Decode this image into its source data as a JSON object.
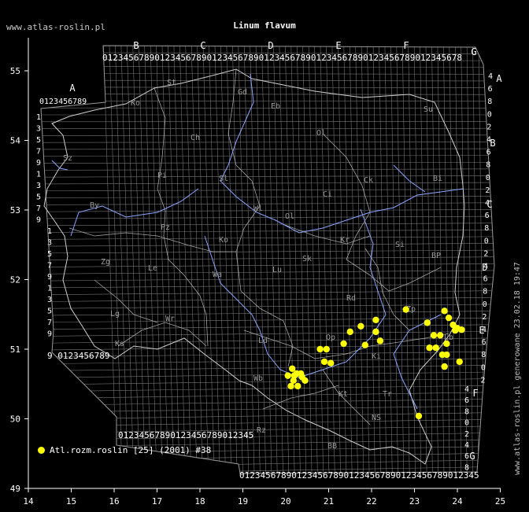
{
  "site_label": "www.atlas-roslin.pl",
  "title": "Linum flavum",
  "side_text": "www.atlas-roslin.pl generowane 23.02.18 19:47",
  "legend": {
    "label": "Atl.rozm.roslin [25] (2001) #38",
    "color": "#ffff00"
  },
  "axes": {
    "x_ticks": [
      14,
      15,
      16,
      17,
      18,
      19,
      20,
      21,
      22,
      23,
      24,
      25
    ],
    "y_ticks": [
      49,
      50,
      51,
      52,
      53,
      54,
      55
    ],
    "x_range": [
      14,
      25
    ],
    "y_range": [
      49,
      55.5
    ]
  },
  "grid": {
    "col_letters": [
      "A",
      "B",
      "C",
      "D",
      "E",
      "F",
      "G"
    ],
    "row_letters": [
      "A",
      "B",
      "C",
      "D",
      "E",
      "F",
      "G"
    ],
    "digit_string": "0123456789",
    "top_digits": "012345678901234567890123456789012345678901234567890123456789012345678",
    "bottom_digits": "0123456789012345678901234567890123456789012345",
    "left_digits": [
      "1",
      "3",
      "5",
      "7",
      "9",
      "1",
      "3",
      "5",
      "7",
      "9",
      "1",
      "3",
      "5",
      "7",
      "9",
      "1",
      "3",
      "5",
      "7",
      "9"
    ],
    "left_bottom_digits": "9 0123456789",
    "right_digits": [
      "4",
      "6",
      "8",
      "0",
      "2",
      "4",
      "6",
      "8",
      "0",
      "2",
      "4",
      "6",
      "8",
      "0",
      "2",
      "4",
      "6",
      "8",
      "0",
      "2",
      "4",
      "6",
      "8",
      "0",
      "2"
    ],
    "lower_right_digits": [
      "4",
      "6",
      "8",
      "0",
      "2",
      "4",
      "6",
      "8"
    ]
  },
  "region_codes": [
    "St",
    "Gd",
    "Eb",
    "Su",
    "Ko",
    "Ch",
    "Ol",
    "Bi",
    "Pi",
    "Ci",
    "Sz",
    "By",
    "Wl",
    "Ck",
    "Ol",
    "Zg",
    "Le",
    "Ko",
    "Sk",
    "BP",
    "Pz",
    "Wa",
    "Lu",
    "Si",
    "Wr",
    "Ld",
    "Rd",
    "Zp",
    "Lg",
    "Op",
    "Ki",
    "Ks",
    "Wb",
    "Kt",
    "Tr",
    "Rz",
    "BB",
    "NS",
    "Kr",
    "Lb",
    "Sl"
  ],
  "records": [
    [
      20.05,
      50.62
    ],
    [
      20.15,
      50.72
    ],
    [
      20.25,
      50.65
    ],
    [
      20.35,
      50.65
    ],
    [
      20.45,
      50.55
    ],
    [
      20.18,
      50.55
    ],
    [
      20.28,
      50.47
    ],
    [
      20.12,
      50.47
    ],
    [
      20.38,
      50.6
    ],
    [
      20.2,
      50.62
    ],
    [
      20.8,
      51.0
    ],
    [
      20.95,
      51.0
    ],
    [
      20.9,
      50.82
    ],
    [
      21.05,
      50.8
    ],
    [
      21.35,
      51.08
    ],
    [
      21.5,
      51.25
    ],
    [
      21.75,
      51.33
    ],
    [
      21.85,
      51.06
    ],
    [
      22.1,
      51.42
    ],
    [
      22.1,
      51.25
    ],
    [
      22.2,
      51.12
    ],
    [
      22.8,
      51.57
    ],
    [
      23.3,
      51.38
    ],
    [
      23.45,
      51.2
    ],
    [
      23.6,
      51.2
    ],
    [
      23.7,
      51.55
    ],
    [
      23.8,
      51.45
    ],
    [
      23.9,
      51.35
    ],
    [
      24.0,
      51.3
    ],
    [
      24.1,
      51.28
    ],
    [
      23.95,
      51.27
    ],
    [
      23.35,
      51.02
    ],
    [
      23.5,
      51.02
    ],
    [
      23.75,
      51.08
    ],
    [
      23.65,
      50.92
    ],
    [
      23.75,
      50.92
    ],
    [
      23.7,
      50.75
    ],
    [
      24.05,
      50.82
    ],
    [
      23.1,
      50.04
    ]
  ]
}
